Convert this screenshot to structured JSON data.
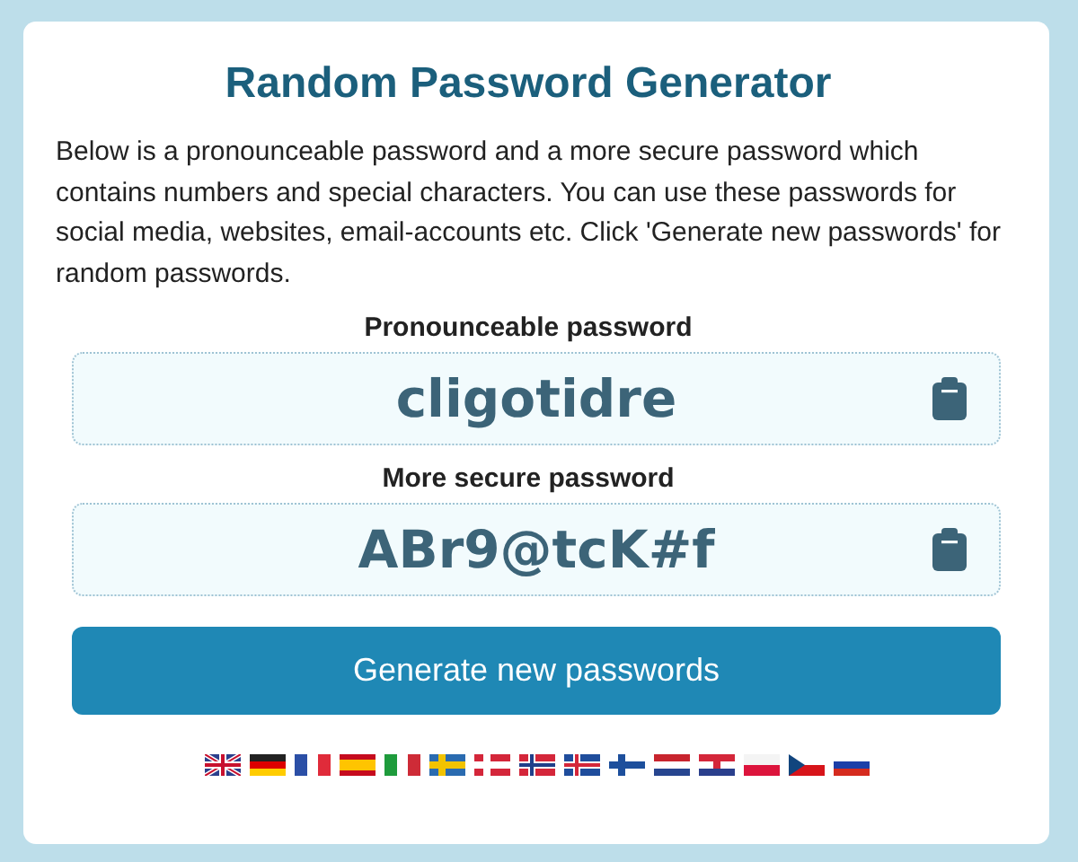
{
  "title": "Random Password Generator",
  "intro": "Below is a pronounceable password and a more secure password which contains numbers and special characters. You can use these passwords for social media, websites, email-accounts etc. Click 'Generate new passwords' for random passwords.",
  "passwords": [
    {
      "label": "Pronounceable password",
      "value": "cligotidre"
    },
    {
      "label": "More secure password",
      "value": "ABr9@tcK#f"
    }
  ],
  "button": "Generate new passwords",
  "languages": [
    {
      "kind": "gb"
    },
    {
      "kind": "de"
    },
    {
      "kind": "fr"
    },
    {
      "kind": "es"
    },
    {
      "kind": "it"
    },
    {
      "kind": "se"
    },
    {
      "kind": "dk"
    },
    {
      "kind": "no"
    },
    {
      "kind": "is"
    },
    {
      "kind": "fi"
    },
    {
      "kind": "nl"
    },
    {
      "kind": "hr"
    },
    {
      "kind": "pl"
    },
    {
      "kind": "cz"
    },
    {
      "kind": "ru"
    }
  ]
}
